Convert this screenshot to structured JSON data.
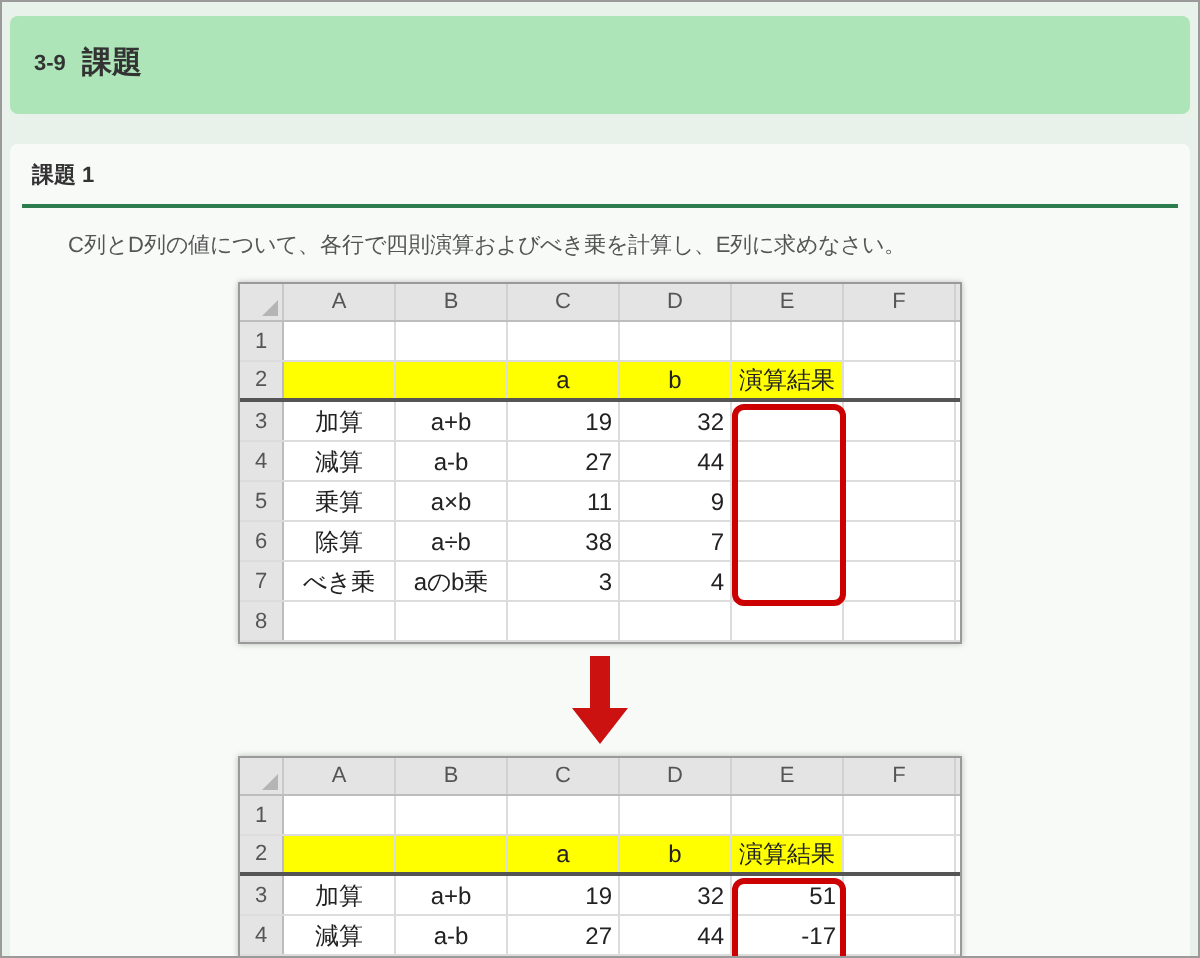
{
  "header": {
    "number": "3-9",
    "title": "課題"
  },
  "section": {
    "title": "課題 1",
    "instruction": "C列とD列の値について、各行で四則演算およびべき乗を計算し、E列に求めなさい。"
  },
  "sheets": [
    {
      "columns": [
        "A",
        "B",
        "C",
        "D",
        "E",
        "F"
      ],
      "rows": [
        {
          "number": "1",
          "highlighted": false,
          "cells": [
            "",
            "",
            "",
            "",
            "",
            ""
          ]
        },
        {
          "number": "2",
          "highlighted": true,
          "cells": [
            "",
            "",
            "a",
            "b",
            "演算結果",
            ""
          ]
        },
        {
          "number": "3",
          "highlighted": false,
          "cells": [
            "加算",
            "a+b",
            "19",
            "32",
            "",
            ""
          ]
        },
        {
          "number": "4",
          "highlighted": false,
          "cells": [
            "減算",
            "a-b",
            "27",
            "44",
            "",
            ""
          ]
        },
        {
          "number": "5",
          "highlighted": false,
          "cells": [
            "乗算",
            "a×b",
            "11",
            "9",
            "",
            ""
          ]
        },
        {
          "number": "6",
          "highlighted": false,
          "cells": [
            "除算",
            "a÷b",
            "38",
            "7",
            "",
            ""
          ]
        },
        {
          "number": "7",
          "highlighted": false,
          "cells": [
            "べき乗",
            "aのb乗",
            "3",
            "4",
            "",
            ""
          ]
        },
        {
          "number": "8",
          "highlighted": false,
          "cells": [
            "",
            "",
            "",
            "",
            "",
            ""
          ]
        }
      ]
    },
    {
      "columns": [
        "A",
        "B",
        "C",
        "D",
        "E",
        "F"
      ],
      "rows": [
        {
          "number": "1",
          "highlighted": false,
          "cells": [
            "",
            "",
            "",
            "",
            "",
            ""
          ]
        },
        {
          "number": "2",
          "highlighted": true,
          "cells": [
            "",
            "",
            "a",
            "b",
            "演算結果",
            ""
          ]
        },
        {
          "number": "3",
          "highlighted": false,
          "cells": [
            "加算",
            "a+b",
            "19",
            "32",
            "51",
            ""
          ]
        },
        {
          "number": "4",
          "highlighted": false,
          "cells": [
            "減算",
            "a-b",
            "27",
            "44",
            "-17",
            ""
          ]
        }
      ]
    }
  ]
}
